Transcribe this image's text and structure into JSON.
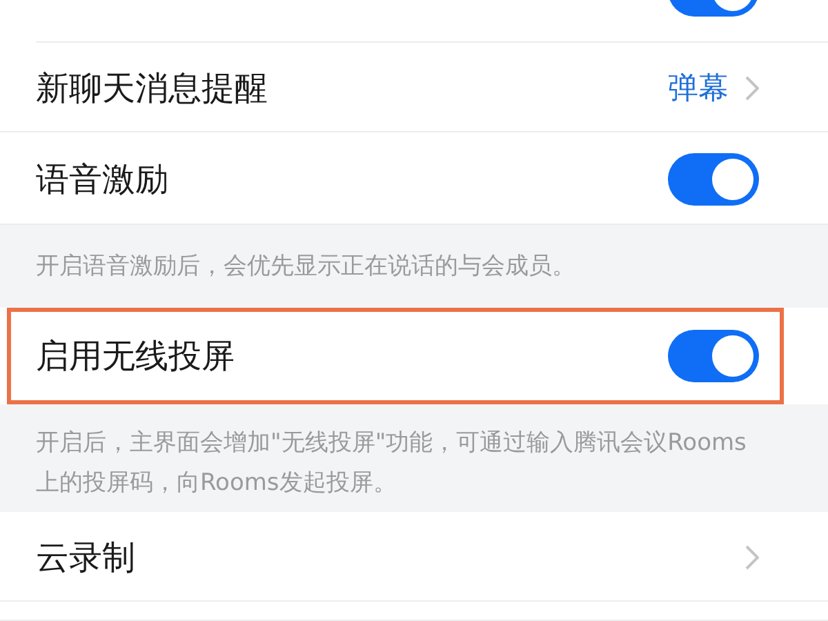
{
  "top_row": {
    "on": true
  },
  "rows": [
    {
      "kind": "link",
      "label": "新聊天消息提醒",
      "value": "弹幕",
      "highlighted": false
    },
    {
      "kind": "toggle",
      "label": "语音激励",
      "on": true,
      "highlighted": false
    },
    {
      "kind": "note",
      "text": "开启语音激励后，会优先显示正在说话的与会成员。"
    },
    {
      "kind": "toggle",
      "label": "启用无线投屏",
      "on": true,
      "highlighted": true
    },
    {
      "kind": "note",
      "text": "开启后，主界面会增加\"无线投屏\"功能，可通过输入腾讯会议Rooms上的投屏码，向Rooms发起投屏。"
    },
    {
      "kind": "link",
      "label": "云录制",
      "highlighted": false
    }
  ]
}
